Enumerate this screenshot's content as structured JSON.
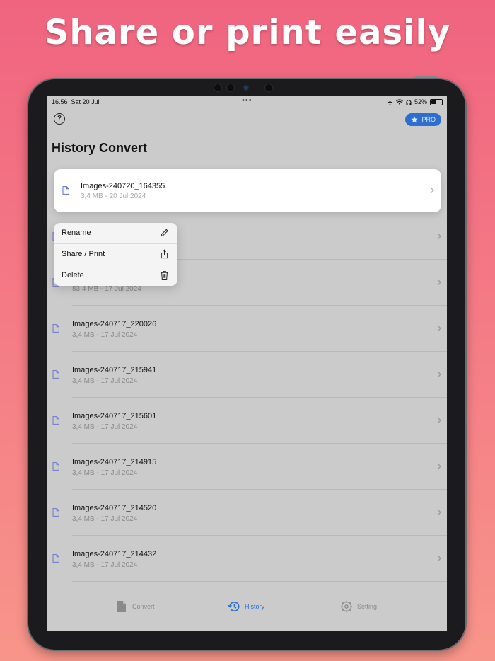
{
  "headline": "Share or print easily",
  "status": {
    "time": "16.56",
    "date": "Sat 20 Jul",
    "battery": "52%",
    "battery_level": 0.52
  },
  "header": {
    "title": "History Convert",
    "pro_label": "PRO",
    "help_icon": "question-circle-icon"
  },
  "selected_item": {
    "name": "Images-240720_164355",
    "meta": "3,4 MB - 20 Jul 2024"
  },
  "context_menu": {
    "items": [
      {
        "label": "Rename",
        "icon": "pencil-icon"
      },
      {
        "label": "Share / Print",
        "icon": "share-icon"
      },
      {
        "label": "Delete",
        "icon": "trash-icon"
      }
    ]
  },
  "history": {
    "items": [
      {
        "name": "",
        "meta": ""
      },
      {
        "name": "",
        "meta": "83,4 MB - 17 Jul 2024"
      },
      {
        "name": "Images-240717_220026",
        "meta": "3,4 MB - 17 Jul 2024"
      },
      {
        "name": "Images-240717_215941",
        "meta": "3,4 MB - 17 Jul 2024"
      },
      {
        "name": "Images-240717_215601",
        "meta": "3,4 MB - 17 Jul 2024"
      },
      {
        "name": "Images-240717_214915",
        "meta": "3,4 MB - 17 Jul 2024"
      },
      {
        "name": "Images-240717_214520",
        "meta": "3,4 MB - 17 Jul 2024"
      },
      {
        "name": "Images-240717_214432",
        "meta": "3,4 MB - 17 Jul 2024"
      }
    ]
  },
  "tabbar": {
    "tabs": [
      {
        "label": "Convert",
        "icon": "document-icon",
        "active": false
      },
      {
        "label": "History",
        "icon": "history-icon",
        "active": true
      },
      {
        "label": "Setting",
        "icon": "gear-icon",
        "active": false
      }
    ]
  },
  "colors": {
    "accent": "#2c6fd1",
    "background_top": "#f0647f",
    "background_bottom": "#f8958a"
  }
}
